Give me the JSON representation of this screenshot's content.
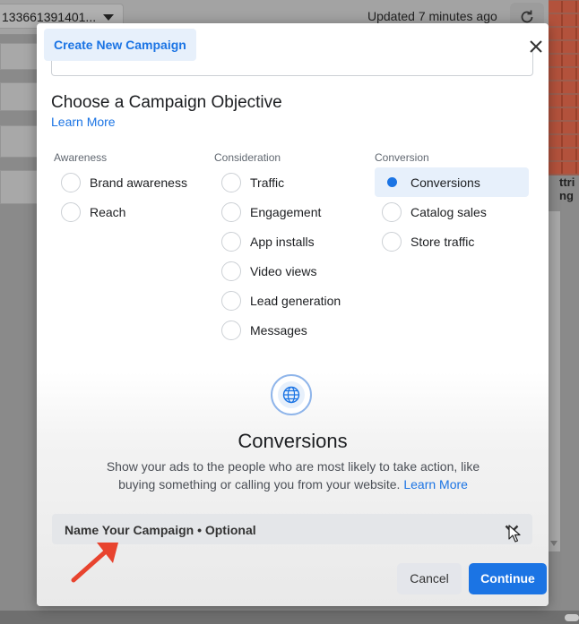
{
  "background": {
    "account_label": "133661391401...",
    "updated_text": "Updated 7 minutes ago",
    "side_text_1": "ttri",
    "side_text_2": "ng"
  },
  "modal": {
    "title": "Create New Campaign",
    "section_title": "Choose a Campaign Objective",
    "learn_more": "Learn More",
    "columns": [
      {
        "heading": "Awareness",
        "options": [
          {
            "label": "Brand awareness",
            "selected": false
          },
          {
            "label": "Reach",
            "selected": false
          }
        ]
      },
      {
        "heading": "Consideration",
        "options": [
          {
            "label": "Traffic",
            "selected": false
          },
          {
            "label": "Engagement",
            "selected": false
          },
          {
            "label": "App installs",
            "selected": false
          },
          {
            "label": "Video views",
            "selected": false
          },
          {
            "label": "Lead generation",
            "selected": false
          },
          {
            "label": "Messages",
            "selected": false
          }
        ]
      },
      {
        "heading": "Conversion",
        "options": [
          {
            "label": "Conversions",
            "selected": true
          },
          {
            "label": "Catalog sales",
            "selected": false
          },
          {
            "label": "Store traffic",
            "selected": false
          }
        ]
      }
    ],
    "detail": {
      "icon": "globe-icon",
      "title": "Conversions",
      "description": "Show your ads to the people who are most likely to take action, like buying something or calling you from your website.",
      "learn_more": "Learn More"
    },
    "name_section": {
      "label": "Name Your Campaign • Optional",
      "expanded": false
    },
    "buttons": {
      "cancel": "Cancel",
      "continue": "Continue"
    }
  },
  "colors": {
    "accent": "#1b74e4",
    "selected_bg": "#e7f0fb",
    "annotation": "#e8432e"
  }
}
